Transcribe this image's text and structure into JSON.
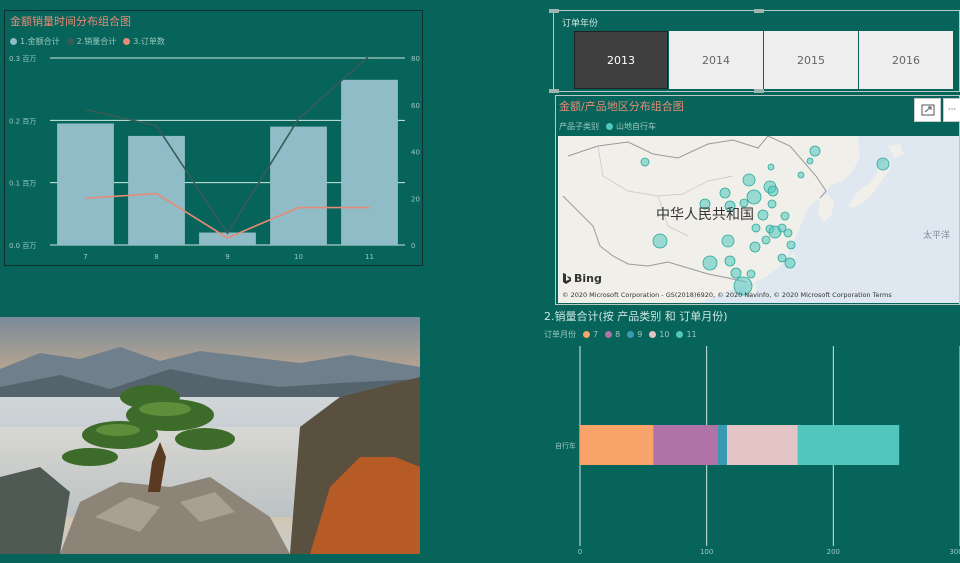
{
  "combo": {
    "title": "金额销量时间分布组合图",
    "legend": [
      {
        "label": "1.金额合计",
        "color": "#8fbcc6"
      },
      {
        "label": "2.销量合计",
        "color": "#3a5c58"
      },
      {
        "label": "3.订单数",
        "color": "#e98a76"
      }
    ],
    "chart_data": {
      "type": "bar",
      "categories": [
        "7",
        "8",
        "9",
        "10",
        "11"
      ],
      "series": [
        {
          "name": "1.金额合计",
          "type": "bar",
          "axis": "left",
          "values": [
            0.195,
            0.175,
            0.02,
            0.19,
            0.265
          ]
        },
        {
          "name": "2.销量合计",
          "type": "line",
          "axis": "right",
          "values": [
            58,
            51,
            5,
            54,
            81
          ]
        },
        {
          "name": "3.订单数",
          "type": "line",
          "axis": "right",
          "values": [
            20,
            22,
            3,
            16,
            16
          ]
        }
      ],
      "left_ticks": [
        "0.0 百万",
        "0.1 百万",
        "0.2 百万",
        "0.3 百万"
      ],
      "right_ticks": [
        "0",
        "20",
        "40",
        "60",
        "80"
      ],
      "ylim_left": [
        0,
        0.3
      ],
      "ylim_right": [
        0,
        80
      ],
      "grid": true,
      "colors": {
        "bar": "#8fbcc6",
        "line_sales": "#3a5c58",
        "line_orders": "#e98a76"
      }
    }
  },
  "slicer": {
    "title": "订单年份",
    "options": [
      {
        "label": "2013",
        "selected": true
      },
      {
        "label": "2014",
        "selected": false
      },
      {
        "label": "2015",
        "selected": false
      },
      {
        "label": "2016",
        "selected": false
      }
    ]
  },
  "map": {
    "title": "金额/产品地区分布组合图",
    "legend_title": "产品子类别",
    "legend_item": "山地自行车",
    "legend_color": "#4fc9bd",
    "country_label": "中华人民共和国",
    "ocean_label": "太平洋",
    "bing_label": "Bing",
    "copyright": "© 2020 Microsoft Corporation - GS(2018)6920, © 2020 Navinfo, © 2020 Microsoft Corporation  Terms",
    "focus_icon": "focus-mode-icon",
    "more_icon": "more-options-icon",
    "more_glyph": "···"
  },
  "bar": {
    "title": "2.销量合计(按 产品类别 和 订单月份)",
    "legend_title": "订单月份",
    "chart_data": {
      "type": "bar",
      "orientation": "horizontal",
      "stacked": true,
      "categories": [
        "自行车"
      ],
      "series": [
        {
          "name": "7",
          "values": [
            58
          ],
          "color": "#f7a36a"
        },
        {
          "name": "8",
          "values": [
            51
          ],
          "color": "#b073a8"
        },
        {
          "name": "9",
          "values": [
            7
          ],
          "color": "#3b9ab3"
        },
        {
          "name": "10",
          "values": [
            56
          ],
          "color": "#e3c5c6"
        },
        {
          "name": "11",
          "values": [
            80
          ],
          "color": "#50c6bc"
        }
      ],
      "xticks": [
        "0",
        "100",
        "200",
        "300"
      ],
      "xlim": [
        0,
        300
      ],
      "grid": true
    }
  }
}
